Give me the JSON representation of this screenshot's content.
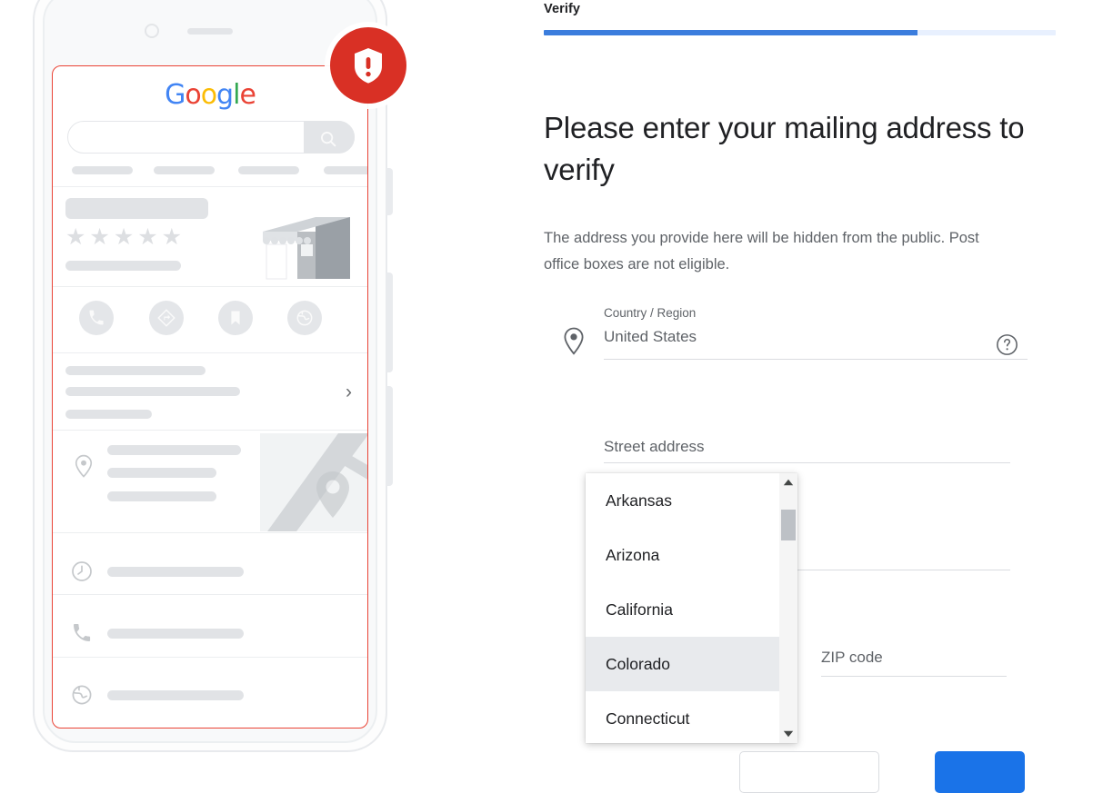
{
  "illustration": {
    "alert_badge_icon": "shield-exclamation-icon",
    "google_logo": {
      "letters": [
        "G",
        "o",
        "o",
        "g",
        "l",
        "e"
      ]
    },
    "search_icon": "search-icon",
    "star_rating_glyphs": "★★★★★",
    "storefront_icon": "storefront-icon",
    "action_icons": [
      "call-icon",
      "directions-icon",
      "save-bookmark-icon",
      "website-globe-icon"
    ],
    "chevron_icon": "chevron-right-icon",
    "map_pin_icon": "map-pin-icon",
    "detail_row_icons": [
      "clock-icon",
      "phone-icon",
      "globe-icon"
    ]
  },
  "header": {
    "step_label": "Verify",
    "progress_percent": 73,
    "progress_fill_color": "#3b7ddd",
    "progress_track_color": "#e8f0fe"
  },
  "main": {
    "title": "Please enter your mailing address to verify",
    "description": "The address you provide here will be hidden from the public. Post office boxes are not eligible.",
    "location_pin_icon": "location-pin-icon",
    "help_icon": "help-circle-icon"
  },
  "form": {
    "country": {
      "label": "Country / Region",
      "value": "United States",
      "placeholder": "Country / Region"
    },
    "street": {
      "label": "Street address",
      "value": "",
      "placeholder": "Street address"
    },
    "zip": {
      "label": "ZIP code",
      "value": "",
      "placeholder": "ZIP code"
    }
  },
  "state_dropdown": {
    "open": true,
    "selected": "Colorado",
    "visible_options": [
      "Arkansas",
      "Arizona",
      "California",
      "Colorado",
      "Connecticut"
    ],
    "scrollbar": {
      "up_arrow_icon": "scroll-up-arrow-icon",
      "down_arrow_icon": "scroll-down-arrow-icon"
    }
  },
  "footer": {
    "secondary_button_label": "",
    "primary_button_label": "",
    "primary_button_color": "#1a73e8"
  }
}
